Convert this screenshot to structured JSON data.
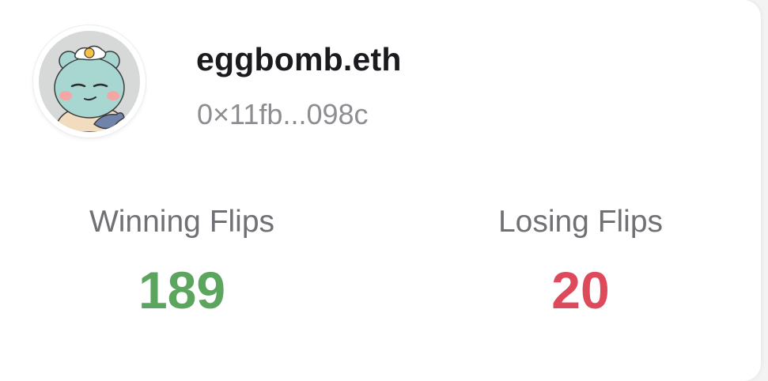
{
  "profile": {
    "display_name": "eggbomb.eth",
    "address": "0×11fb...098c",
    "avatar_icon": "bear-with-fried-egg-avatar"
  },
  "stats": {
    "winning_label": "Winning Flips",
    "winning_value": "189",
    "losing_label": "Losing Flips",
    "losing_value": "20"
  },
  "colors": {
    "win": "#5ca55f",
    "lose": "#dd4a5b",
    "name": "#1b1b1f",
    "muted": "#8d8d92"
  }
}
